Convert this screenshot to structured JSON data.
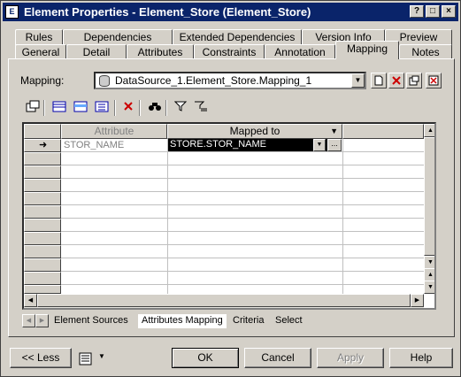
{
  "window": {
    "app_icon": "E",
    "title": "Element Properties - Element_Store (Element_Store)",
    "controls": {
      "help": "?",
      "minimize": "_",
      "maximize": "□",
      "close": "×"
    }
  },
  "tabs_row1": [
    {
      "label": "Rules"
    },
    {
      "label": "Dependencies"
    },
    {
      "label": "Extended Dependencies"
    },
    {
      "label": "Version Info"
    },
    {
      "label": "Preview"
    }
  ],
  "tabs_row2": [
    {
      "label": "General"
    },
    {
      "label": "Detail"
    },
    {
      "label": "Attributes"
    },
    {
      "label": "Constraints"
    },
    {
      "label": "Annotation"
    },
    {
      "label": "Mapping",
      "active": true
    },
    {
      "label": "Notes"
    }
  ],
  "mapping": {
    "label": "Mapping:",
    "value": "DataSource_1.Element_Store.Mapping_1",
    "dropdown_arrow": "▼"
  },
  "grid": {
    "columns": [
      "Attribute",
      "Mapped to"
    ],
    "rows": [
      {
        "attribute": "STOR_NAME",
        "mapped_to": "STORE.STOR_NAME",
        "current": true
      }
    ],
    "row_indicator": "➜",
    "ellipsis": "..."
  },
  "subtabs": [
    "Element Sources",
    "Attributes Mapping",
    "Criteria",
    "Select"
  ],
  "buttons": {
    "less": "<< Less",
    "ok": "OK",
    "cancel": "Cancel",
    "apply": "Apply",
    "help": "Help"
  }
}
